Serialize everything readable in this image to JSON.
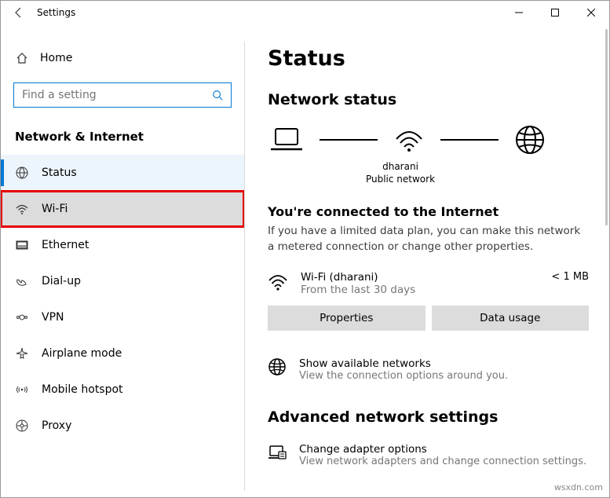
{
  "window": {
    "title": "Settings"
  },
  "sidebar": {
    "home": "Home",
    "search_placeholder": "Find a setting",
    "section": "Network & Internet",
    "items": [
      {
        "label": "Status"
      },
      {
        "label": "Wi-Fi"
      },
      {
        "label": "Ethernet"
      },
      {
        "label": "Dial-up"
      },
      {
        "label": "VPN"
      },
      {
        "label": "Airplane mode"
      },
      {
        "label": "Mobile hotspot"
      },
      {
        "label": "Proxy"
      }
    ]
  },
  "main": {
    "title": "Status",
    "network_status_heading": "Network status",
    "diagram": {
      "wifi_name": "dharani",
      "wifi_sub": "Public network"
    },
    "connected_heading": "You're connected to the Internet",
    "connected_sub": "If you have a limited data plan, you can make this network a metered connection or change other properties.",
    "net": {
      "name": "Wi-Fi (dharani)",
      "sub": "From the last 30 days",
      "usage": "< 1 MB"
    },
    "properties_btn": "Properties",
    "data_usage_btn": "Data usage",
    "show_available": {
      "title": "Show available networks",
      "sub": "View the connection options around you."
    },
    "advanced_heading": "Advanced network settings",
    "adapter": {
      "title": "Change adapter options",
      "sub": "View network adapters and change connection settings."
    }
  },
  "watermark": "wsxdn.com"
}
